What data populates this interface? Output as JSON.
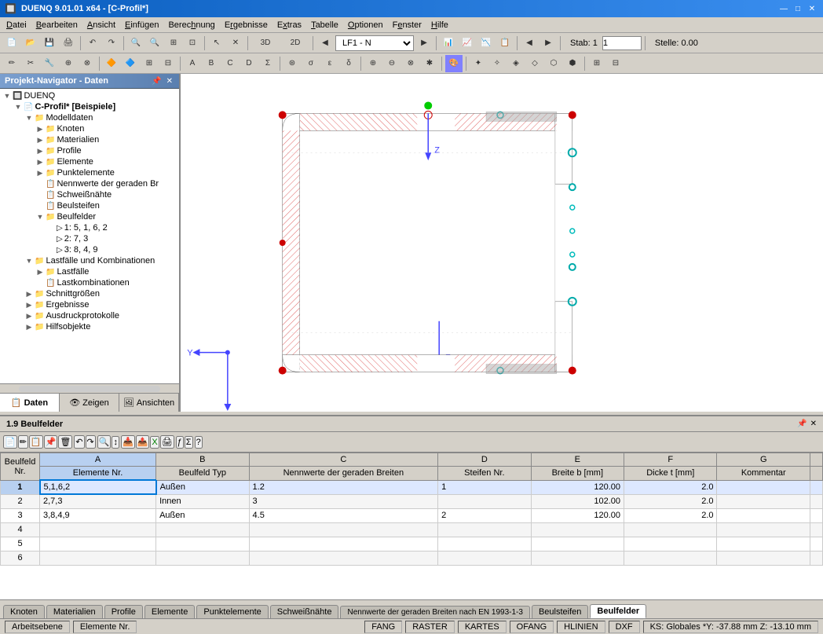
{
  "titlebar": {
    "title": "DUENQ 9.01.01 x64 - [C-Profil*]",
    "controls": [
      "—",
      "□",
      "✕"
    ]
  },
  "menu": {
    "items": [
      "Datei",
      "Bearbeiten",
      "Ansicht",
      "Einfügen",
      "Berechnung",
      "Ergebnisse",
      "Extras",
      "Tabelle",
      "Optionen",
      "Fenster",
      "Hilfe"
    ]
  },
  "toolbar1": {
    "dropdown_lf": "LF1 - N",
    "stab_label": "Stab: 1",
    "stelle_label": "Stelle: 0.00"
  },
  "navigator": {
    "title": "Projekt-Navigator - Daten",
    "tree": [
      {
        "label": "DUENQ",
        "level": 0,
        "icon": "📁",
        "type": "root"
      },
      {
        "label": "C-Profil* [Beispiele]",
        "level": 1,
        "icon": "📄",
        "type": "project"
      },
      {
        "label": "Modelldaten",
        "level": 2,
        "icon": "📁",
        "type": "folder"
      },
      {
        "label": "Knoten",
        "level": 3,
        "icon": "📁",
        "type": "folder"
      },
      {
        "label": "Materialien",
        "level": 3,
        "icon": "📁",
        "type": "folder"
      },
      {
        "label": "Profile",
        "level": 3,
        "icon": "📁",
        "type": "folder"
      },
      {
        "label": "Elemente",
        "level": 3,
        "icon": "📁",
        "type": "folder"
      },
      {
        "label": "Punktelemente",
        "level": 3,
        "icon": "📁",
        "type": "folder"
      },
      {
        "label": "Nennwerte der geraden Br",
        "level": 3,
        "icon": "📋",
        "type": "item"
      },
      {
        "label": "Schweißnähte",
        "level": 3,
        "icon": "📋",
        "type": "item"
      },
      {
        "label": "Beulsteifen",
        "level": 3,
        "icon": "📋",
        "type": "item"
      },
      {
        "label": "Beulfelder",
        "level": 3,
        "icon": "📁",
        "type": "folder",
        "expanded": true
      },
      {
        "label": "1: 5, 1, 6, 2",
        "level": 4,
        "icon": "▷",
        "type": "leaf"
      },
      {
        "label": "2: 7, 3",
        "level": 4,
        "icon": "▷",
        "type": "leaf"
      },
      {
        "label": "3: 8, 4, 9",
        "level": 4,
        "icon": "▷",
        "type": "leaf"
      },
      {
        "label": "Lastfälle und Kombinationen",
        "level": 2,
        "icon": "📁",
        "type": "folder"
      },
      {
        "label": "Lastfälle",
        "level": 3,
        "icon": "📁",
        "type": "folder"
      },
      {
        "label": "Lastkombinationen",
        "level": 3,
        "icon": "📋",
        "type": "item"
      },
      {
        "label": "Schnittgrößen",
        "level": 2,
        "icon": "📁",
        "type": "folder"
      },
      {
        "label": "Ergebnisse",
        "level": 2,
        "icon": "📁",
        "type": "folder"
      },
      {
        "label": "Ausdruckprotokolle",
        "level": 2,
        "icon": "📁",
        "type": "folder"
      },
      {
        "label": "Hilfsobjekte",
        "level": 2,
        "icon": "📁",
        "type": "folder"
      }
    ],
    "bottom_tabs": [
      "Daten",
      "Zeigen",
      "Ansichten"
    ]
  },
  "panel": {
    "title": "1.9 Beulfelder",
    "columns": [
      "Beulfeld Nr.",
      "Elemente Nr.",
      "Beulfeld Typ",
      "Nennwerte der geraden Breiten",
      "Steifen Nr.",
      "Breite b [mm]",
      "Dicke t [mm]",
      "Kommentar"
    ],
    "col_letters": [
      "A",
      "B",
      "C",
      "D",
      "E",
      "F",
      "G"
    ],
    "rows": [
      {
        "nr": 1,
        "elemente": "5,1,6,2",
        "typ": "Außen",
        "nennwerte": "1.2",
        "steifen": "1",
        "breite": "120.00",
        "dicke": "2.0",
        "kommentar": ""
      },
      {
        "nr": 2,
        "elemente": "2,7,3",
        "typ": "Innen",
        "nennwerte": "3",
        "steifen": "",
        "breite": "102.00",
        "dicke": "2.0",
        "kommentar": ""
      },
      {
        "nr": 3,
        "elemente": "3,8,4,9",
        "typ": "Außen",
        "nennwerte": "4.5",
        "steifen": "2",
        "breite": "120.00",
        "dicke": "2.0",
        "kommentar": ""
      },
      {
        "nr": 4,
        "elemente": "",
        "typ": "",
        "nennwerte": "",
        "steifen": "",
        "breite": "",
        "dicke": "",
        "kommentar": ""
      },
      {
        "nr": 5,
        "elemente": "",
        "typ": "",
        "nennwerte": "",
        "steifen": "",
        "breite": "",
        "dicke": "",
        "kommentar": ""
      },
      {
        "nr": 6,
        "elemente": "",
        "typ": "",
        "nennwerte": "",
        "steifen": "",
        "breite": "",
        "dicke": "",
        "kommentar": ""
      }
    ]
  },
  "bottom_tabs": {
    "items": [
      "Knoten",
      "Materialien",
      "Profile",
      "Elemente",
      "Punktelemente",
      "Schweißnähte",
      "Nennwerte der geraden Breiten nach EN 1993-1-3",
      "Beulsteifen",
      "Beulfelder"
    ],
    "active": "Beulfelder"
  },
  "status_bar": {
    "left": "Arbeitsebene",
    "elements_label": "Elemente Nr.",
    "sections": [
      "FANG",
      "RASTER",
      "KARTES",
      "OFANG",
      "HLINIEN",
      "DXF"
    ],
    "active_sections": [],
    "coords": "KS: Globales *Y: -37.88 mm   Z: -13.10 mm"
  },
  "canvas": {
    "axis_y_label": "Y",
    "axis_z_label": "Z"
  }
}
